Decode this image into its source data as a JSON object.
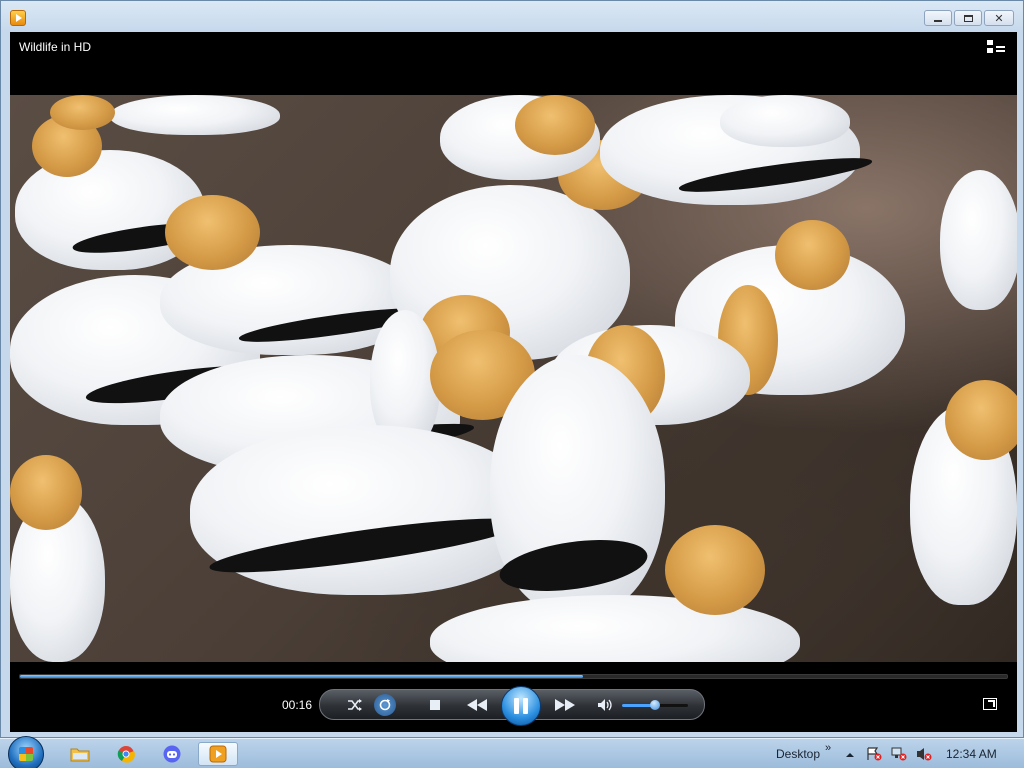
{
  "window": {
    "title": "Wildlife in HD",
    "buttons": [
      "minimize",
      "maximize",
      "close"
    ]
  },
  "player": {
    "elapsed": "00:16",
    "progress_fraction": 0.57,
    "volume_fraction": 0.5,
    "state": "playing",
    "accent_color": "#2b8fe0"
  },
  "taskbar": {
    "pinned": [
      "file-explorer",
      "chrome",
      "discord",
      "windows-media-player"
    ],
    "desktop_label": "Desktop",
    "chevron": "»",
    "clock": "12:34 AM"
  }
}
